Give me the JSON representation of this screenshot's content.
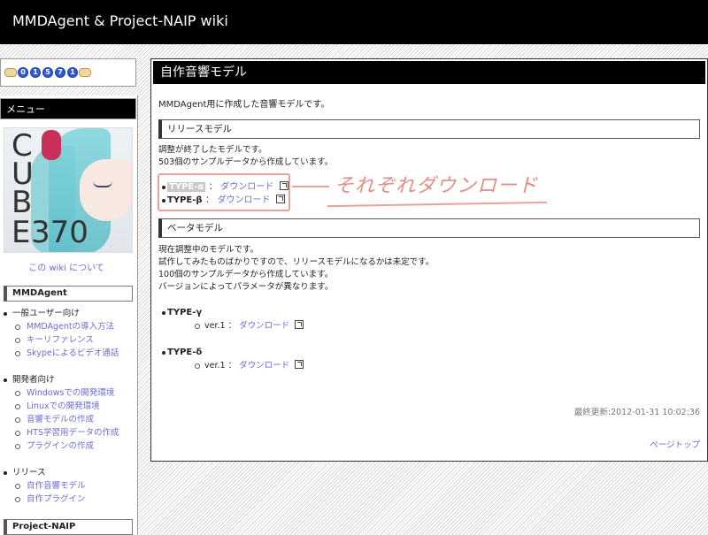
{
  "site": {
    "title": "MMDAgent & Project-NAIP wiki"
  },
  "counter": {
    "digits": [
      "0",
      "1",
      "5",
      "7",
      "1"
    ]
  },
  "sidebar": {
    "menu_title": "メニュー",
    "logo": {
      "line1": "C",
      "line2": "U",
      "line3": "B",
      "line4": "E",
      "num": "370"
    },
    "about_link": "この wiki について",
    "section1_title": "MMDAgent",
    "group_user": "一般ユーザー向け",
    "user_items": [
      "MMDAgentの導入方法",
      "キーリファレンス",
      "Skypeによるビデオ通話"
    ],
    "group_dev": "開発者向け",
    "dev_items": [
      "Windowsでの開発環境",
      "Linuxでの開発環境",
      "音響モデルの作成",
      "HTS学習用データの作成",
      "プラグインの作成"
    ],
    "group_release": "リリース",
    "release_items": [
      "自作音響モデル",
      "自作プラグイン"
    ],
    "section2_title": "Project-NAIP"
  },
  "main": {
    "title": "自作音響モデル",
    "intro": "MMDAgent用に作成した音響モデルです。",
    "release": {
      "heading": "リリースモデル",
      "line1": "調整が終了したモデルです。",
      "line2": "503個のサンプルデータから作成しています。",
      "types": [
        {
          "name": "TYPE-α",
          "sep": "：",
          "link": "ダウンロード"
        },
        {
          "name": "TYPE-β",
          "sep": "：",
          "link": "ダウンロード"
        }
      ]
    },
    "beta": {
      "heading": "ベータモデル",
      "line1": "現在調整中のモデルです。",
      "line2": "試作してみたものばかりですので、リリースモデルになるかは未定です。",
      "line3": "100個のサンプルデータから作成しています。",
      "line4": "バージョンによってパラメータが異なります。",
      "types": [
        {
          "name": "TYPE-γ",
          "ver": "ver.1",
          "sep": "：",
          "link": "ダウンロード"
        },
        {
          "name": "TYPE-δ",
          "ver": "ver.1",
          "sep": "：",
          "link": "ダウンロード"
        }
      ]
    },
    "updated": "最終更新:2012-01-31 10:02:36",
    "page_top": "ページトップ"
  },
  "annotation": {
    "text": "それぞれダウンロード",
    "color": "#e48d84"
  },
  "colors": {
    "link": "#6b6bd6",
    "header_bg": "#000000"
  }
}
